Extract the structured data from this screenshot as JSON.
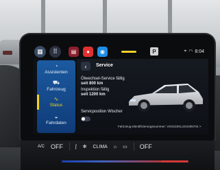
{
  "status": {
    "parking_badge": "P",
    "time": "8:04",
    "wifi_icon": "wifi-icon",
    "pin_icon": "location-icon"
  },
  "apps": [
    {
      "name": "grid-icon"
    },
    {
      "name": "apps-icon"
    },
    {
      "name": "car-app-icon"
    },
    {
      "name": "red-app-icon"
    },
    {
      "name": "blue-app-icon"
    }
  ],
  "sidebar": {
    "items": [
      {
        "label": "Assistenten",
        "icon": "assistant-icon"
      },
      {
        "label": "Fahrzeug",
        "icon": "car-icon"
      },
      {
        "label": "Status",
        "icon": "status-wave-icon"
      },
      {
        "label": "Fahrdaten",
        "icon": "gauge-icon"
      }
    ]
  },
  "page": {
    "title": "Service",
    "oil_service_title": "Ölwechsel-Service fällig",
    "oil_service_value": "seit 800 km",
    "inspection_title": "Inspektion fällig",
    "inspection_value": "seit 1200 km",
    "wiper_label": "Servicposition Wischer",
    "vin_line": "Fahrzeug-Identifizierungsnummer: VSS22ZKL2S1005704 >"
  },
  "climate": {
    "ac_label": "A/C",
    "left_temp": "OFF",
    "climate_label": "CLIMA",
    "right_temp": "OFF"
  },
  "colors": {
    "accent": "#f4d32a",
    "sidebar": "#1c5aa0",
    "screen_bg": "#0d1015"
  }
}
